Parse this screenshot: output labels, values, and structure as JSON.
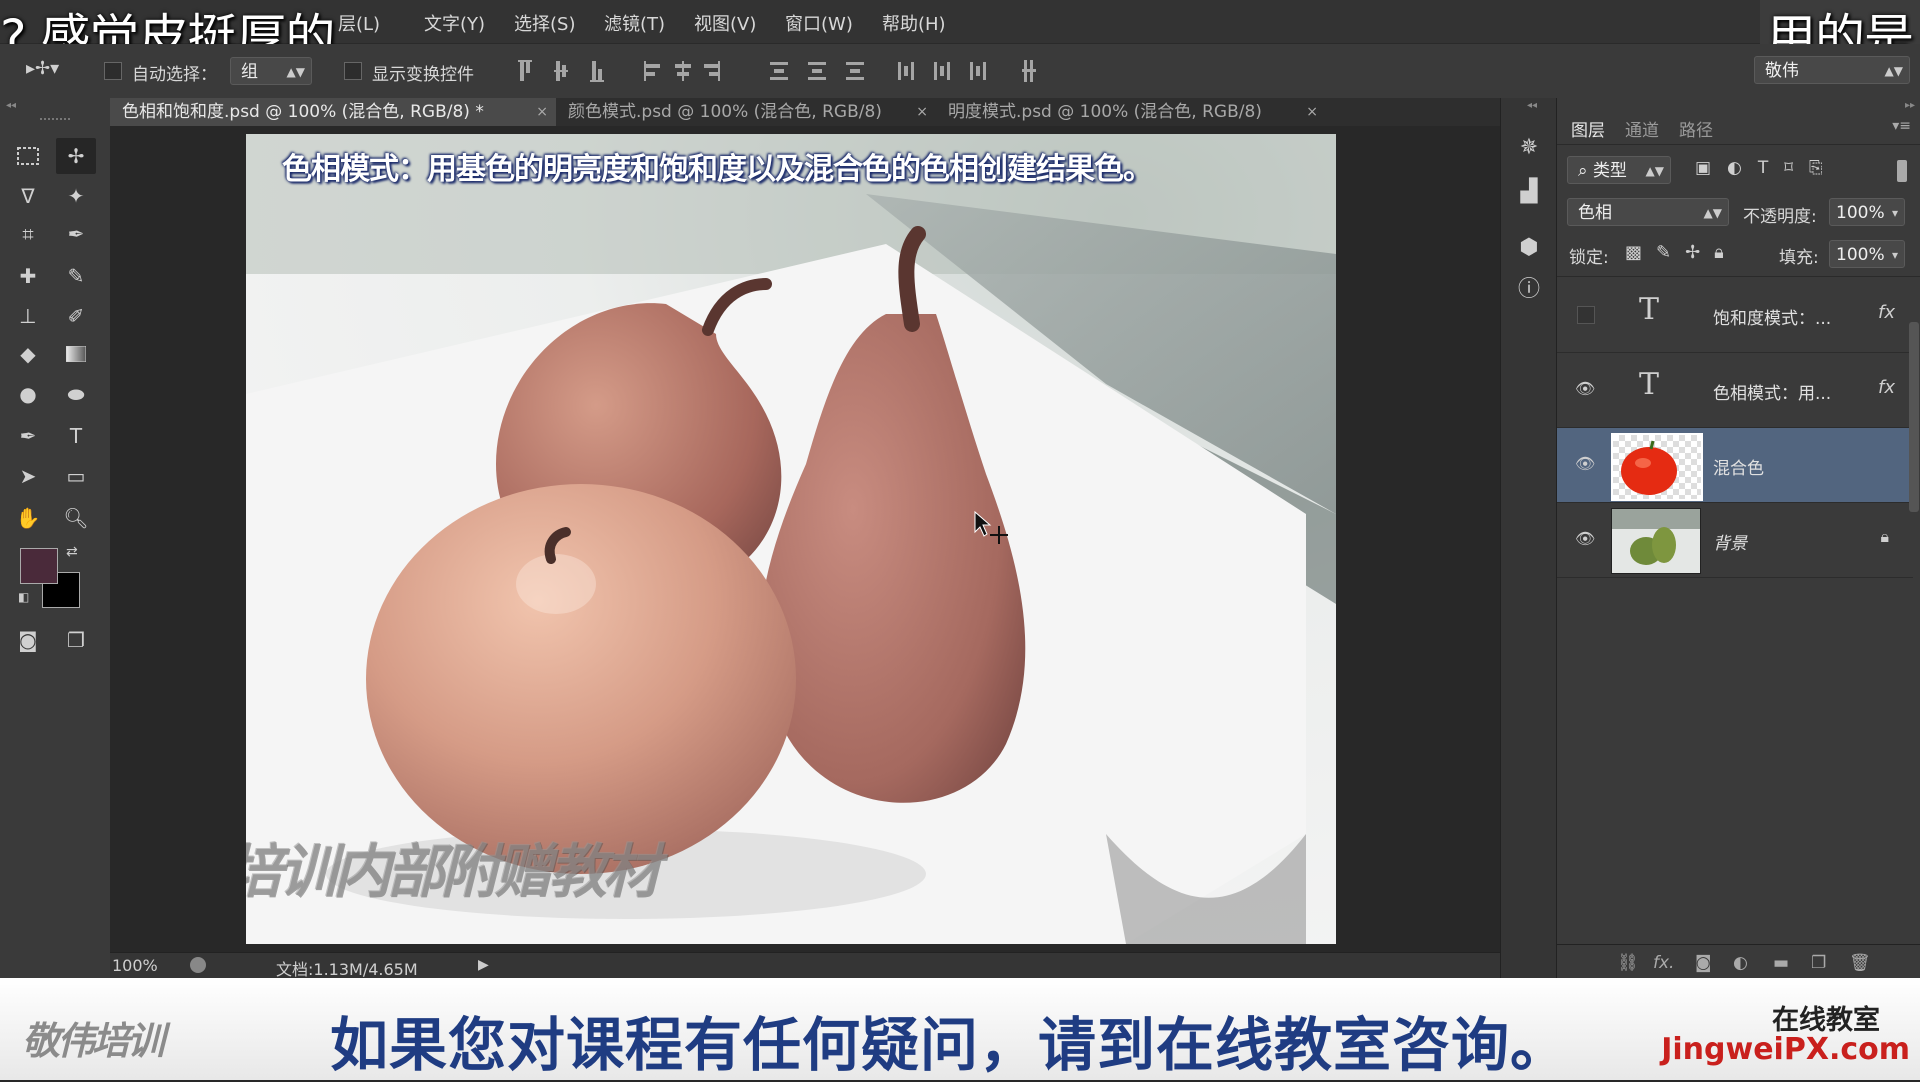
{
  "overlay": {
    "left_text": "? 感觉皮挺厚的",
    "right_text": "用的是"
  },
  "menubar": {
    "items": [
      "层(L)",
      "文字(Y)",
      "选择(S)",
      "滤镜(T)",
      "视图(V)",
      "窗口(W)",
      "帮助(H)"
    ]
  },
  "options": {
    "auto_select_label": "自动选择：",
    "auto_select_value": "组",
    "show_transform_label": "显示变换控件",
    "workspace_value": "敬伟"
  },
  "tabs": [
    {
      "label": "色相和饱和度.psd @ 100% (混合色, RGB/8) *",
      "close": "×"
    },
    {
      "label": "颜色模式.psd @ 100% (混合色, RGB/8)",
      "close": "×"
    },
    {
      "label": "明度模式.psd @ 100% (混合色, RGB/8)",
      "close": "×"
    }
  ],
  "canvas": {
    "headline": "色相模式：用基色的明亮度和饱和度以及混合色的色相创建结果色。",
    "watermark": "敬伟培训内部附赠教材"
  },
  "status": {
    "zoom": "100%",
    "doc_info": "文档:1.13M/4.65M"
  },
  "layers_panel": {
    "tabs": [
      "图层",
      "通道",
      "路径"
    ],
    "filter_label": "类型",
    "blend_mode": "色相",
    "opacity_label": "不透明度:",
    "opacity_value": "100%",
    "lock_label": "锁定:",
    "fill_label": "填充:",
    "fill_value": "100%",
    "layers": [
      {
        "name": "饱和度模式：...",
        "type": "text",
        "visible": false,
        "fx": "fx"
      },
      {
        "name": "色相模式：用...",
        "type": "text",
        "visible": true,
        "fx": "fx"
      },
      {
        "name": "混合色",
        "type": "image",
        "visible": true,
        "selected": true
      },
      {
        "name": "背景",
        "type": "image",
        "visible": true,
        "locked": true
      }
    ]
  },
  "banner": {
    "logo": "敬伟培训",
    "message": "如果您对课程有任何疑问，请到在线教室咨询。",
    "label_cn": "在线教室",
    "label_url": "JingweiPX.com"
  },
  "colors": {
    "foreground": "#4a2a3a",
    "background": "#000000",
    "selected_layer": "#52657f",
    "banner_text": "#1f3c82",
    "banner_url": "#c9201d"
  }
}
